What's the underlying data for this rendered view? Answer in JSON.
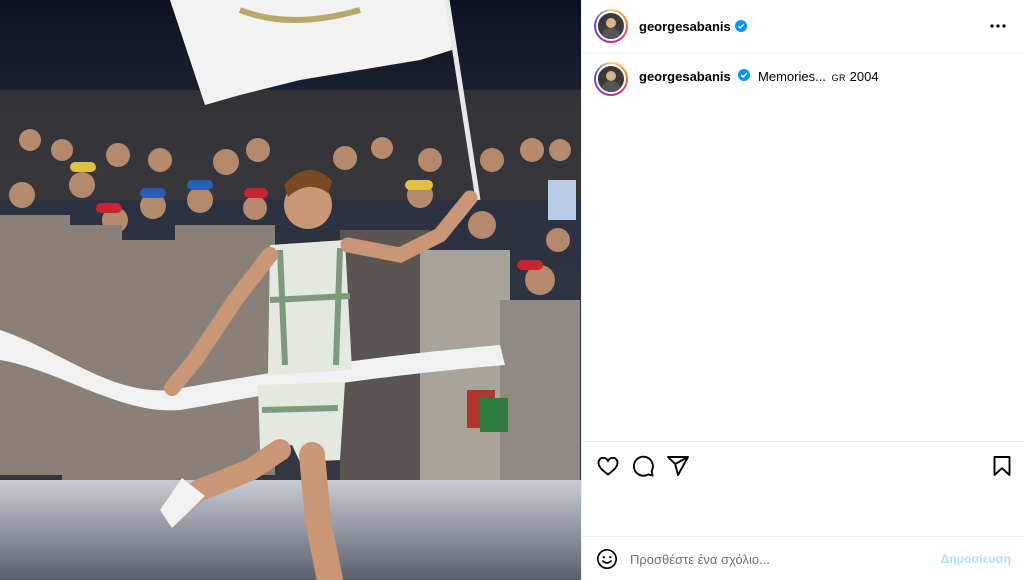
{
  "post": {
    "username": "georgesabanis",
    "verified": true,
    "caption_text": "Memories...",
    "caption_flag": "GR",
    "caption_year": "2004"
  },
  "icons": {
    "more": "more-options-icon",
    "like": "heart-icon",
    "comment": "comment-icon",
    "share": "paper-plane-icon",
    "save": "bookmark-icon",
    "emoji": "emoji-icon",
    "verified": "verified-badge-icon"
  },
  "comment_box": {
    "placeholder": "Προσθέστε ένα σχόλιο...",
    "post_label": "Δημοσίευση"
  },
  "colors": {
    "verified_blue": "#0095f6",
    "post_button_disabled": "#b2dffc"
  }
}
